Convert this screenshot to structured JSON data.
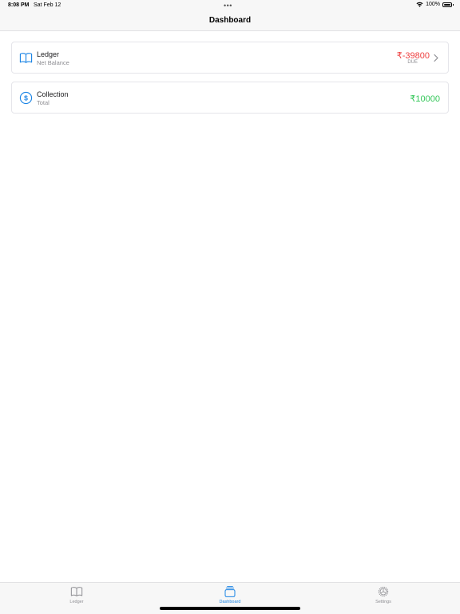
{
  "status_bar": {
    "time": "8:08 PM",
    "date": "Sat Feb 12",
    "battery": "100%"
  },
  "nav": {
    "title": "Dashboard"
  },
  "cards": {
    "ledger": {
      "title": "Ledger",
      "subtitle": "Net Balance",
      "amount": "₹-39800",
      "status": "DUE",
      "icon": "book-icon"
    },
    "collection": {
      "title": "Collection",
      "subtitle": "Total",
      "amount": "₹10000",
      "icon": "dollar-circle-icon"
    }
  },
  "tabs": [
    {
      "label": "Ledger",
      "icon": "book-icon",
      "selected": false
    },
    {
      "label": "Dashboard",
      "icon": "stack-icon",
      "selected": true
    },
    {
      "label": "Settings",
      "icon": "gear-icon",
      "selected": false
    }
  ],
  "colors": {
    "accent": "#1a84e5",
    "negative": "#ee3e3e",
    "positive": "#34c759",
    "secondary_text": "#8e8e93"
  }
}
